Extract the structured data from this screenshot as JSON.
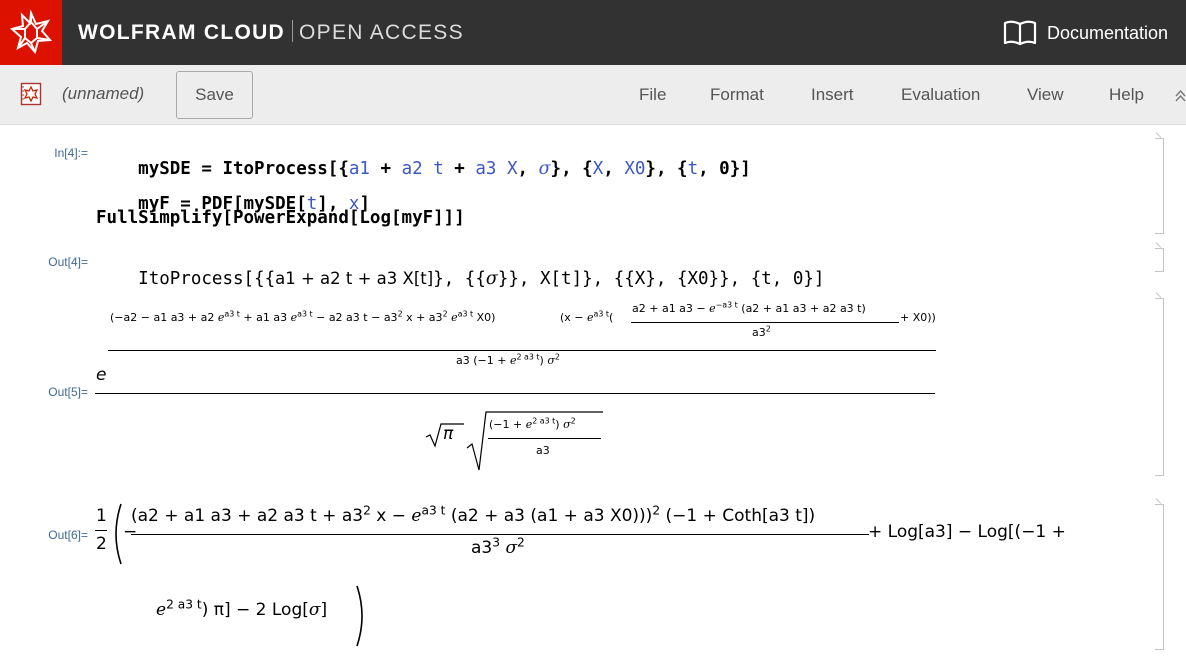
{
  "banner": {
    "brand_main": "WOLFRAM CLOUD",
    "brand_sub": "OPEN ACCESS",
    "documentation_label": "Documentation",
    "logo_color": "#dd1100",
    "bar_color": "#323232"
  },
  "toolbar": {
    "notebook_name": "(unnamed)",
    "save_label": "Save",
    "menus": [
      "File",
      "Format",
      "Insert",
      "Evaluation",
      "View",
      "Help"
    ],
    "collapse_icon": "chevron-up-icon"
  },
  "cells": {
    "in4_label": "In[4]:=",
    "in4_line1": [
      "mySDE = ItoProcess[{",
      "a1",
      " + ",
      "a2",
      " ",
      "t",
      " + ",
      "a3",
      " ",
      "X",
      ", ",
      "σ",
      "}, {",
      "X",
      ", ",
      "X0",
      "}, {",
      "t",
      ", 0}]"
    ],
    "in4_line2": [
      "myF = PDF[mySDE[",
      "t",
      "], ",
      "x",
      "]"
    ],
    "in4_line3": "FullSimplify[PowerExpand[Log[myF]]]",
    "out4_label": "Out[4]=",
    "out4_text": [
      "ItoProcess[{{",
      "a1 + a2 t + a3 X[t]",
      "}, {{",
      "σ",
      "}}, X[t]}, {{X}, {X0}}, {t, 0}]"
    ],
    "out5_label": "Out[5]=",
    "out5": {
      "base": "e",
      "exp_num_left": "(−a2 − a1 a3 + a2 e",
      "exp_num_parts": [
        "(−a2 − a1 a3 + a2 ",
        "e",
        "a3 t",
        " + a1 a3 ",
        "e",
        "a3 t",
        " − a2 a3 t − a3",
        "2",
        " x + a3",
        "2",
        " ",
        "e",
        "a3 t",
        " X0)",
        "(x − ",
        "e",
        "a3 t",
        "(",
        ")"
      ],
      "inner_num": [
        "a2 + a1 a3 − ",
        "e",
        "−a3 t",
        " (a2 + a1 a3 + a2 a3 t)"
      ],
      "inner_den": [
        "a3",
        "2"
      ],
      "inner_tail": " + X0",
      "exp_den": [
        "a3 (−1 + ",
        "e",
        "2 a3 t",
        ") ",
        "σ",
        "2"
      ],
      "denominator_sqrt_pi": "π",
      "sqrt_num": [
        "(−1 + ",
        "e",
        "2 a3 t",
        ") ",
        "σ",
        "2"
      ],
      "sqrt_den": "a3"
    },
    "out6_label": "Out[6]=",
    "out6": {
      "half_num": "1",
      "half_den": "2",
      "frac_num": [
        "(a2 + a1 a3 + a2 a3 t + a3",
        "2",
        " x − ",
        "e",
        "a3 t",
        " (a2 + a3 (a1 + a3 X0)))",
        "2",
        " (−1 + Coth[a3 t])"
      ],
      "frac_den": [
        "a3",
        "3",
        " ",
        "σ",
        "2"
      ],
      "tail_line1": " + Log[a3] − Log[(−1 + ",
      "tail_line2": [
        "e",
        "2 a3 t",
        ") π] − 2 Log[",
        "σ",
        "]"
      ],
      "neg_sign": "−"
    }
  },
  "colors": {
    "symbol_blue": "#3b56c8",
    "label_blue": "#41689a",
    "toolbar_bg": "#ededed"
  }
}
